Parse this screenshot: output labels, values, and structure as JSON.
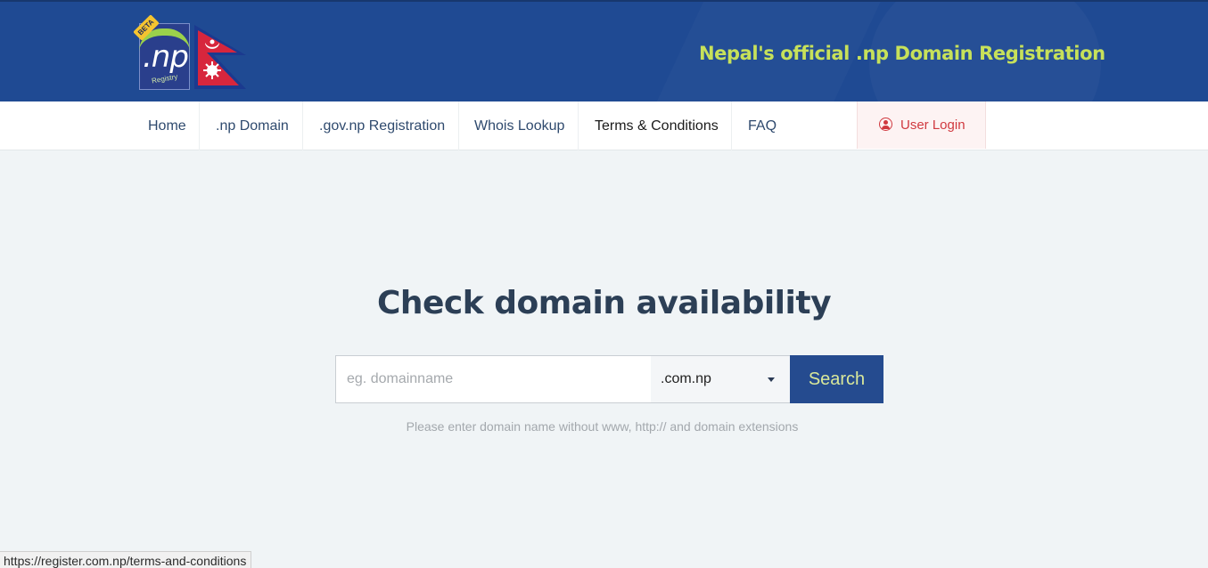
{
  "header": {
    "logo": {
      "text": ".np",
      "subtext": "Registry",
      "badge": "BETA"
    },
    "tagline": "Nepal's official .np Domain Registration",
    "colors": {
      "header_bg": "#1f4a93",
      "tagline": "#c7e15a",
      "accent": "#254b8f",
      "login_text": "#d0393f"
    }
  },
  "nav": {
    "items": [
      {
        "label": "Home"
      },
      {
        "label": ".np Domain"
      },
      {
        "label": ".gov.np Registration"
      },
      {
        "label": "Whois Lookup"
      },
      {
        "label": "Terms & Conditions"
      },
      {
        "label": "FAQ"
      }
    ],
    "login": {
      "label": "User Login",
      "icon": "user-circle-icon"
    }
  },
  "main": {
    "heading": "Check domain availability",
    "search": {
      "placeholder": "eg. domainname",
      "value": "",
      "extension": ".com.np",
      "button": "Search"
    },
    "hint": "Please enter domain name without www, http:// and domain extensions"
  },
  "statusbar": {
    "url": "https://register.com.np/terms-and-conditions"
  }
}
